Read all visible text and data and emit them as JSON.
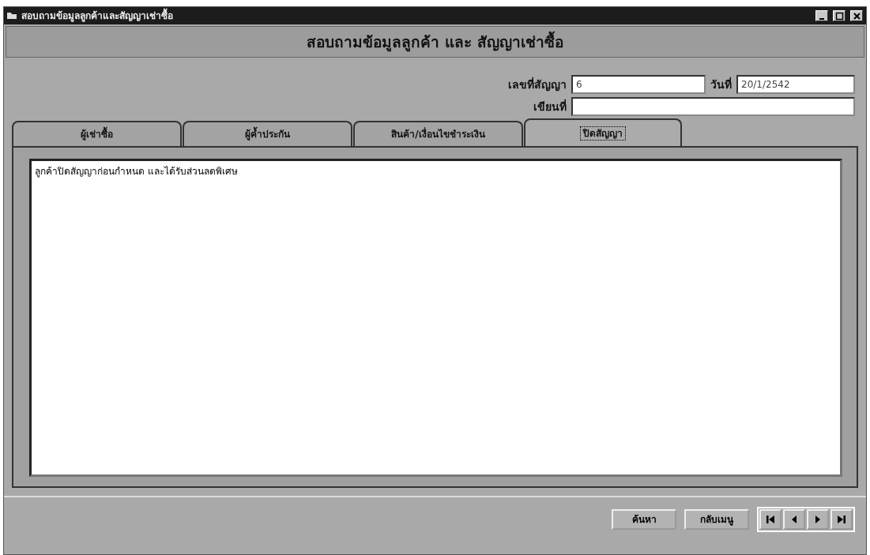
{
  "window": {
    "title": "สอบถามข้อมูลลูกค้าและสัญญาเช่าซื้อ"
  },
  "header": {
    "title": "สอบถามข้อมูลลูกค้า และ  สัญญาเช่าซื้อ"
  },
  "fields": [
    {
      "label": "เลขที่สัญญา",
      "value": "6"
    },
    {
      "label": "วันที่",
      "value": "20/1/2542"
    },
    {
      "label": "เขียนที่"
    }
  ],
  "tabs": [
    {
      "label": "ผู้เช่าซื้อ",
      "selected": false
    },
    {
      "label": "ผู้ค้ำประกัน",
      "selected": false
    },
    {
      "label": "สินค้า/เงื่อนไขชำระเงิน",
      "selected": false
    },
    {
      "label": "ปิดสัญญา",
      "selected": true
    }
  ],
  "note": {
    "value": "ลูกค้าปิดสัญญาก่อนกำหนด และได้รับส่วนลดพิเศษ"
  },
  "buttons": [
    {
      "label": "ค้นหา"
    },
    {
      "label": "กลับเมนู"
    }
  ],
  "navigation": [
    {
      "kind": "first"
    },
    {
      "kind": "previous"
    },
    {
      "kind": "next"
    },
    {
      "kind": "last"
    }
  ]
}
